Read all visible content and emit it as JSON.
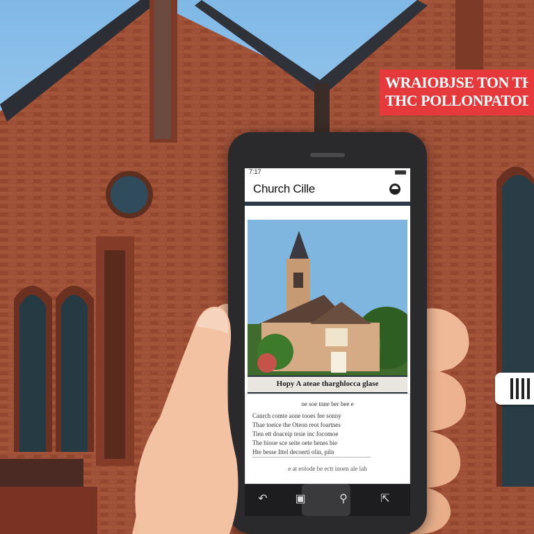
{
  "banner": {
    "line1": "WRAIOBJSE TON THE GOI",
    "line2": "THC POLLONPATODOCTR"
  },
  "app": {
    "status_time": "7:17",
    "title": "Church Cille",
    "photo_caption": "Hopy A ateae tharghlocca glase",
    "body_lead": "oe soe tnne ber bee e",
    "body_lines": [
      "Canrch comte   aone tooes fee sonny",
      "Thae toeice the Oteon reot foartnes",
      "Tien ett  doaceip tesie inc focomoe",
      "The biooe sce seite oete benes bie",
      "Hte besse  Ittel decoerti olin, piln"
    ],
    "body_footer": "e at eolode be ectt inoen ale lah"
  },
  "icons": {
    "pin": "location-pin-icon",
    "back": "back-arrow-icon",
    "gallery": "gallery-icon",
    "search": "search-icon",
    "expand": "expand-icon",
    "barcode": "barcode-icon"
  },
  "colors": {
    "brick": "#9a4a33",
    "banner": "#e5393b",
    "phone": "#2a2a2c",
    "appbar_accent": "#2d3b4d"
  }
}
